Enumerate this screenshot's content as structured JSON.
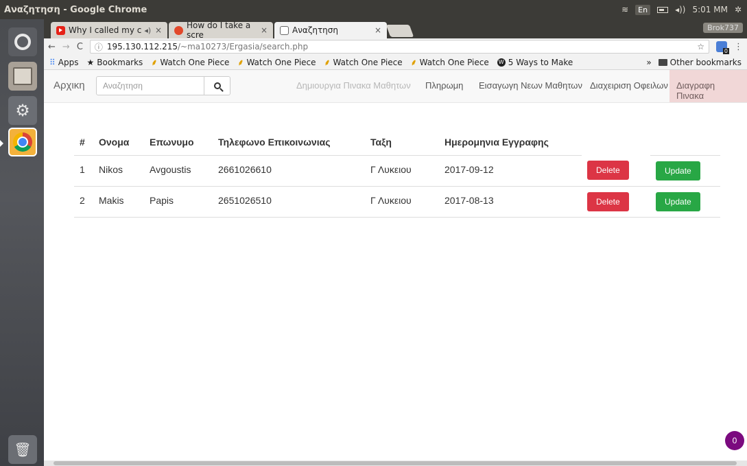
{
  "window": {
    "title": "Αναζητηση - Google Chrome"
  },
  "system": {
    "lang": "En",
    "volume_icon": "speaker-icon",
    "time": "5:01 ΜΜ"
  },
  "tabs": [
    {
      "label": "Why I called my c",
      "icon": "youtube-icon",
      "audio": "◂)"
    },
    {
      "label": "How do I take a scre",
      "icon": "askubuntu-icon"
    },
    {
      "label": "Αναζητηση",
      "icon": "document-icon"
    }
  ],
  "profile_name": "Brok737",
  "address_bar": {
    "domain": "195.130.112.215",
    "path": "/~ma10273/Ergasia/search.php"
  },
  "bookmarks": {
    "apps": "Apps",
    "bookmarks": "Bookmarks",
    "items": [
      "Watch One Piece",
      "Watch One Piece",
      "Watch One Piece",
      "Watch One Piece",
      "5 Ways to Make"
    ],
    "more": "»",
    "other": "Other bookmarks"
  },
  "nav": {
    "brand": "Αρχικη",
    "search_placeholder": "Αναζητηση",
    "links": [
      "Δημιουργια Πινακα Μαθητων",
      "Πληρωμη",
      "Εισαγωγη Νεων Μαθητων",
      "Διαχειριση Οφειλων",
      "Διαγραφη Πινακα"
    ]
  },
  "table": {
    "headers": [
      "#",
      "Ονομα",
      "Επωνυμο",
      "Τηλεφωνο Επικοινωνιας",
      "Ταξη",
      "Ημερομηνια Εγγραφης"
    ],
    "rows": [
      {
        "num": "1",
        "first": "Nikos",
        "last": "Avgoustis",
        "phone": "2661026610",
        "class": "Γ Λυκειου",
        "date": "2017-09-12"
      },
      {
        "num": "2",
        "first": "Makis",
        "last": "Papis",
        "phone": "2651026510",
        "class": "Γ Λυκειου",
        "date": "2017-08-13"
      }
    ],
    "delete_label": "Delete",
    "update_label": "Update"
  },
  "badge_count": "0",
  "colors": {
    "danger": "#dc3545",
    "success": "#28a745",
    "badge": "#7b0a7f"
  }
}
